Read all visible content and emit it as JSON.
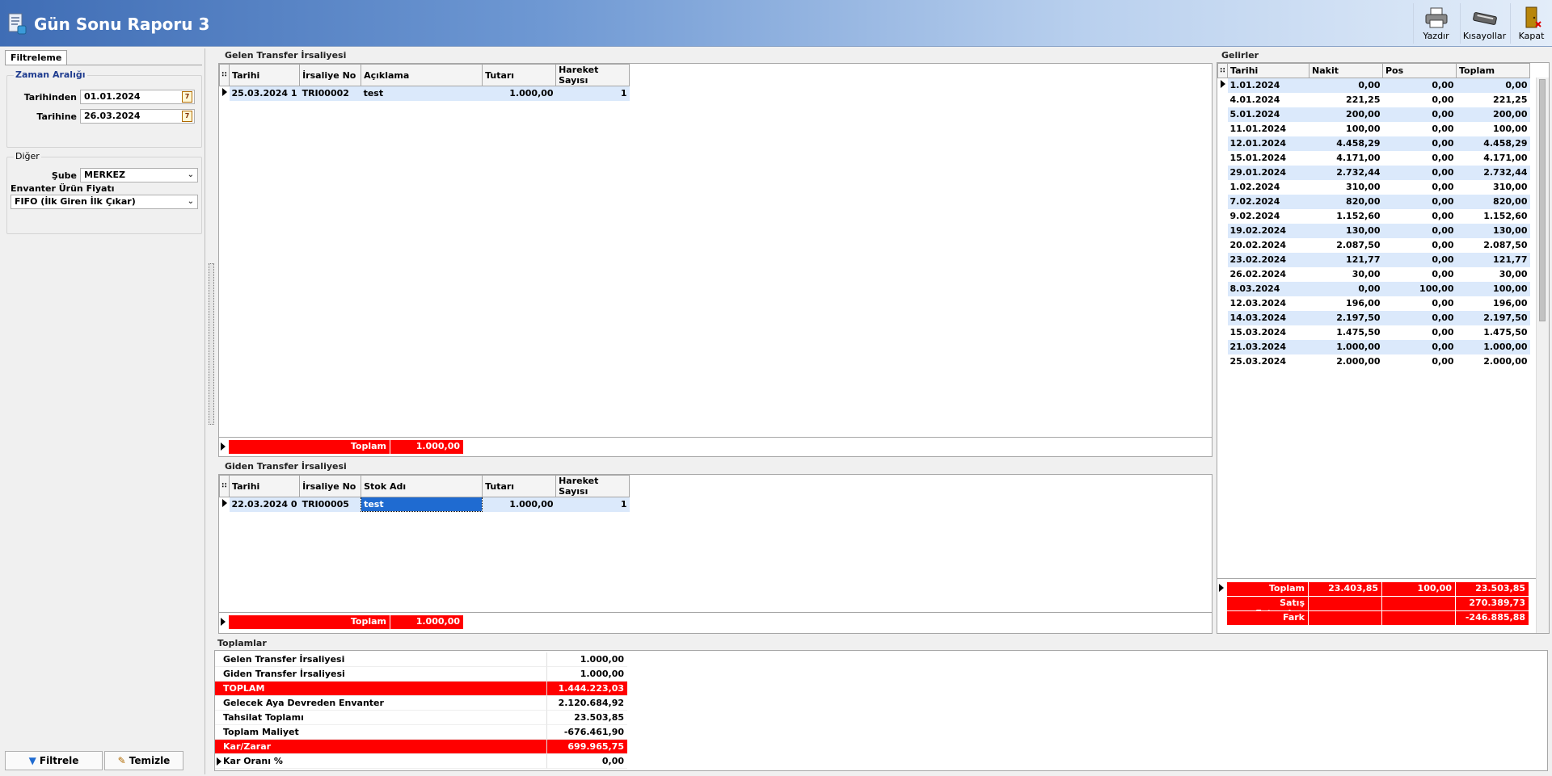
{
  "header": {
    "title": "Gün Sonu Raporu 3"
  },
  "toolbar": {
    "print_label": "Yazdır",
    "shortcuts_label": "Kısayollar",
    "close_label": "Kapat"
  },
  "filter": {
    "tab_label": "Filtreleme",
    "date_group_title": "Zaman Aralığı",
    "from_label": "Tarihinden",
    "from_value": "01.01.2024",
    "to_label": "Tarihine",
    "to_value": "26.03.2024",
    "other_group_title": "Diğer",
    "branch_label": "Şube",
    "branch_value": "MERKEZ",
    "price_label": "Envanter Ürün Fiyatı",
    "price_value": "FIFO (İlk Giren İlk Çıkar)",
    "filter_button": "Filtrele",
    "clear_button": "Temizle"
  },
  "incoming": {
    "title": "Gelen Transfer İrsaliyesi",
    "columns": [
      "Tarihi",
      "İrsaliye No",
      "Açıklama",
      "Tutarı",
      "Hareket Sayısı"
    ],
    "rows": [
      [
        "25.03.2024 1",
        "TRI00002",
        "test",
        "1.000,00",
        "1"
      ]
    ],
    "footer_label": "Toplam",
    "footer_value": "1.000,00"
  },
  "outgoing": {
    "title": "Giden Transfer İrsaliyesi",
    "columns": [
      "Tarihi",
      "İrsaliye No",
      "Stok Adı",
      "Tutarı",
      "Hareket Sayısı"
    ],
    "rows": [
      [
        "22.03.2024 0",
        "TRI00005",
        "test",
        "1.000,00",
        "1"
      ]
    ],
    "footer_label": "Toplam",
    "footer_value": "1.000,00"
  },
  "income": {
    "title": "Gelirler",
    "columns": [
      "Tarihi",
      "Nakit",
      "Pos",
      "Toplam"
    ],
    "rows": [
      [
        "1.01.2024",
        "0,00",
        "0,00",
        "0,00"
      ],
      [
        "4.01.2024",
        "221,25",
        "0,00",
        "221,25"
      ],
      [
        "5.01.2024",
        "200,00",
        "0,00",
        "200,00"
      ],
      [
        "11.01.2024",
        "100,00",
        "0,00",
        "100,00"
      ],
      [
        "12.01.2024",
        "4.458,29",
        "0,00",
        "4.458,29"
      ],
      [
        "15.01.2024",
        "4.171,00",
        "0,00",
        "4.171,00"
      ],
      [
        "29.01.2024",
        "2.732,44",
        "0,00",
        "2.732,44"
      ],
      [
        "1.02.2024",
        "310,00",
        "0,00",
        "310,00"
      ],
      [
        "7.02.2024",
        "820,00",
        "0,00",
        "820,00"
      ],
      [
        "9.02.2024",
        "1.152,60",
        "0,00",
        "1.152,60"
      ],
      [
        "19.02.2024",
        "130,00",
        "0,00",
        "130,00"
      ],
      [
        "20.02.2024",
        "2.087,50",
        "0,00",
        "2.087,50"
      ],
      [
        "23.02.2024",
        "121,77",
        "0,00",
        "121,77"
      ],
      [
        "26.02.2024",
        "30,00",
        "0,00",
        "30,00"
      ],
      [
        "8.03.2024",
        "0,00",
        "100,00",
        "100,00"
      ],
      [
        "12.03.2024",
        "196,00",
        "0,00",
        "196,00"
      ],
      [
        "14.03.2024",
        "2.197,50",
        "0,00",
        "2.197,50"
      ],
      [
        "15.03.2024",
        "1.475,50",
        "0,00",
        "1.475,50"
      ],
      [
        "21.03.2024",
        "1.000,00",
        "0,00",
        "1.000,00"
      ],
      [
        "25.03.2024",
        "2.000,00",
        "0,00",
        "2.000,00"
      ]
    ],
    "footer": [
      [
        "Toplam",
        "23.403,85",
        "100,00",
        "23.503,85"
      ],
      [
        "Satış Faturaları",
        "",
        "",
        "270.389,73"
      ],
      [
        "Fark",
        "",
        "",
        "-246.885,88"
      ]
    ]
  },
  "totals": {
    "title": "Toplamlar",
    "rows": [
      {
        "label": "Gelen Transfer İrsaliyesi",
        "value": "1.000,00",
        "red": false
      },
      {
        "label": "Giden Transfer İrsaliyesi",
        "value": "1.000,00",
        "red": false
      },
      {
        "label": "TOPLAM",
        "value": "1.444.223,03",
        "red": true
      },
      {
        "label": "Gelecek Aya Devreden Envanter",
        "value": "2.120.684,92",
        "red": false
      },
      {
        "label": "Tahsilat Toplamı",
        "value": "23.503,85",
        "red": false
      },
      {
        "label": "Toplam Maliyet",
        "value": "-676.461,90",
        "red": false
      },
      {
        "label": "Kar/Zarar",
        "value": "699.965,75",
        "red": true
      },
      {
        "label": "Kar Oranı %",
        "value": "0,00",
        "red": false
      }
    ]
  }
}
